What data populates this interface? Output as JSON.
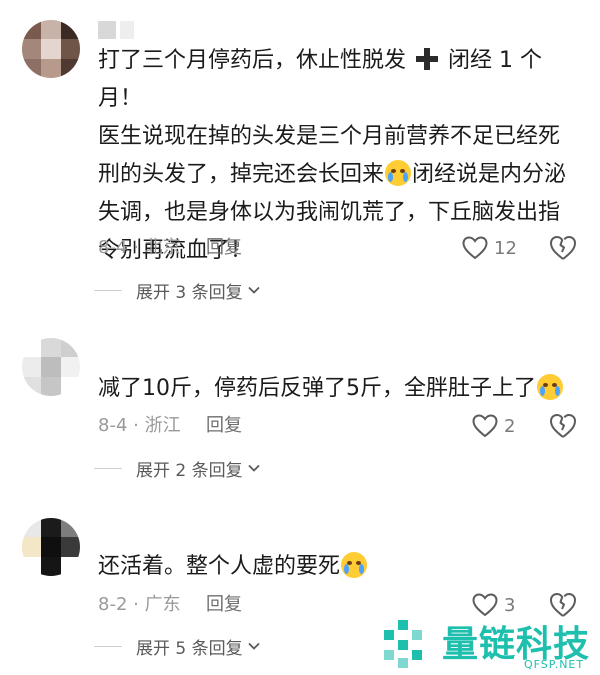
{
  "comments": [
    {
      "avatar_colors": [
        "#7a5a4e",
        "#c9b2a7",
        "#3b2a24",
        "#a3877a",
        "#e4d6ce",
        "#6e5548",
        "#8d7063",
        "#b89a8c",
        "#4e3a31"
      ],
      "text_a": "打了三个月停药后，休止性脱发",
      "text_b": "闭经 1 个月！\n医生说现在掉的头发是三个月前营养不足已经死刑的头发了，掉完还会长回来",
      "text_c": "闭经说是内分泌失调，也是身体以为我闹饥荒了，下丘脑发出指令别再流血了！",
      "meta": "8-4 · 北京",
      "reply": "回复",
      "likes": "12",
      "expand": "展开 3 条回复"
    },
    {
      "avatar_colors": [
        "#ffffff",
        "#d9d9d9",
        "#cfcfcf",
        "#ececec",
        "#bdbdbd",
        "#f1f1f1",
        "#e0e0e0",
        "#c6c6c6",
        "#ffffff"
      ],
      "text": "减了10斤，停药后反弹了5斤，全胖肚子上了",
      "meta": "8-4 · 浙江",
      "reply": "回复",
      "likes": "2",
      "expand": "展开 2 条回复"
    },
    {
      "avatar_colors": [
        "#e8e8e8",
        "#1b1b1b",
        "#7d7d7d",
        "#f4e7c8",
        "#0f0f0f",
        "#3a3a3a",
        "#ffffff",
        "#151515",
        "#ffffff"
      ],
      "text": "还活着。整个人虚的要死",
      "meta": "8-2 · 广东",
      "reply": "回复",
      "likes": "3",
      "expand": "展开 5 条回复"
    }
  ],
  "watermark": {
    "title": "量链科技",
    "subtitle": "QFSP.NET"
  },
  "colors": {
    "brand": "#1fbfae",
    "muted": "#9a9a9a",
    "text": "#1b1b1b"
  }
}
